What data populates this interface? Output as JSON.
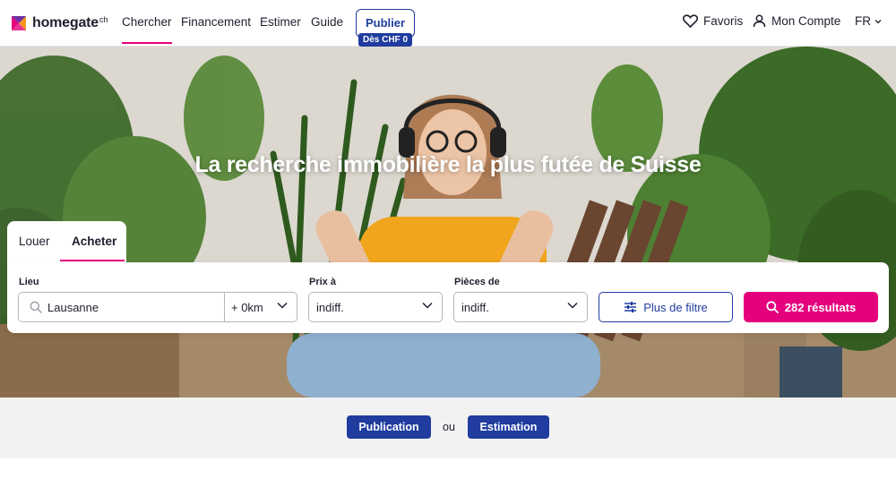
{
  "header": {
    "logo_text": "homegate",
    "logo_suffix": "ch",
    "nav": [
      "Chercher",
      "Financement",
      "Estimer",
      "Guide"
    ],
    "publish_label": "Publier",
    "publish_badge": "Dès CHF 0",
    "favorites_label": "Favoris",
    "account_label": "Mon Compte",
    "language": "FR"
  },
  "hero": {
    "title": "La recherche immobilière la plus futée de Suisse"
  },
  "search": {
    "tabs": [
      "Louer",
      "Acheter"
    ],
    "active_tab": "Acheter",
    "location_label": "Lieu",
    "location_value": "Lausanne",
    "radius_value": "+ 0km",
    "price_label": "Prix à",
    "price_value": "indiff.",
    "rooms_label": "Pièces de",
    "rooms_value": "indiff.",
    "filter_label": "Plus de filtre",
    "results_label": "282 résultats"
  },
  "bottom": {
    "publication_label": "Publication",
    "or_label": "ou",
    "estimation_label": "Estimation"
  },
  "colors": {
    "brand_pink": "#e5007d",
    "brand_blue": "#1f3c9e",
    "text_dark": "#1f1f2e"
  }
}
